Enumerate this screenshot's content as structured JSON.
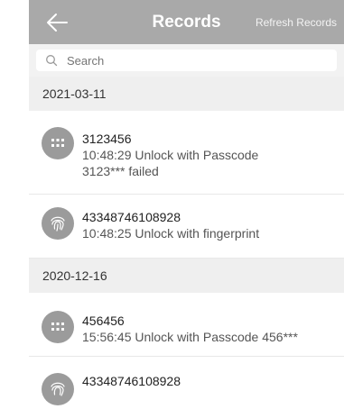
{
  "header": {
    "title": "Records",
    "refresh_label": "Refresh Records"
  },
  "search": {
    "placeholder": "Search"
  },
  "groups": [
    {
      "date": "2021-03-11",
      "records": [
        {
          "icon": "keypad-icon",
          "line1": "3123456",
          "line2": "10:48:29 Unlock with Passcode",
          "line3": "3123*** failed"
        },
        {
          "icon": "fingerprint-icon",
          "line1": "43348746108928",
          "line2": "10:48:25 Unlock with fingerprint"
        }
      ]
    },
    {
      "date": "2020-12-16",
      "records": [
        {
          "icon": "keypad-icon",
          "line1": "456456",
          "line2": "15:56:45 Unlock with Passcode 456***"
        },
        {
          "icon": "fingerprint-icon",
          "line1": "43348746108928"
        }
      ]
    }
  ]
}
